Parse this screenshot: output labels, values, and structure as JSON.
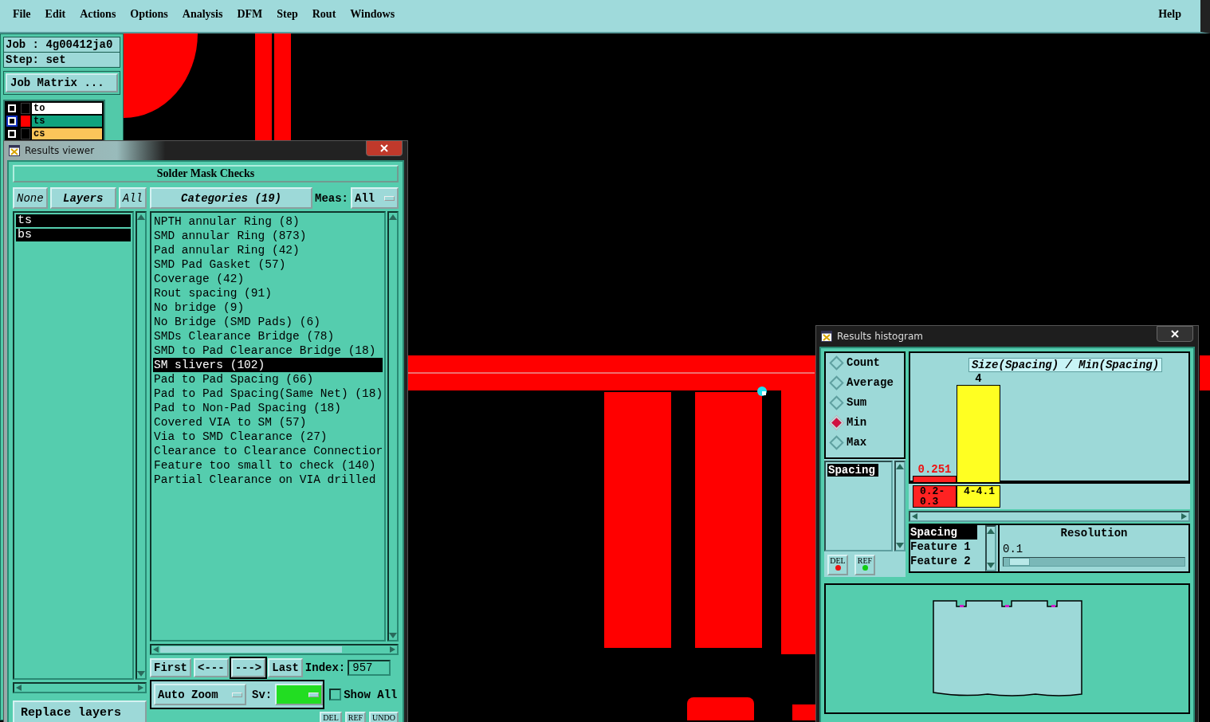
{
  "menu_bar": {
    "items": [
      "File",
      "Edit",
      "Actions",
      "Options",
      "Analysis",
      "DFM",
      "Step",
      "Rout",
      "Windows"
    ],
    "help": "Help"
  },
  "job_panel": {
    "job": "Job : 4g00412ja0",
    "step": "Step: set",
    "matrix_button": "Job Matrix ...",
    "layers": [
      {
        "name": "to",
        "color": "#ffffff",
        "checked": true,
        "selected": false
      },
      {
        "name": "ts",
        "color": "#0fa37f",
        "checked": true,
        "selected": true
      },
      {
        "name": "cs",
        "color": "#fbc55a",
        "checked": true,
        "selected": false
      }
    ]
  },
  "results_viewer": {
    "title": "Results viewer",
    "heading": "Solder Mask Checks",
    "layer_buttons": [
      "None",
      "Layers",
      "All"
    ],
    "layers": [
      {
        "name": "ts",
        "selected": true
      },
      {
        "name": "bs",
        "selected": true
      }
    ],
    "categories_button": "Categories (19)",
    "meas_label": "Meas:",
    "meas_value": "All",
    "categories": [
      {
        "label": "NPTH annular Ring (8)",
        "selected": false
      },
      {
        "label": "SMD annular Ring (873)",
        "selected": false
      },
      {
        "label": "Pad annular Ring (42)",
        "selected": false
      },
      {
        "label": "SMD Pad Gasket (57)",
        "selected": false
      },
      {
        "label": "Coverage (42)",
        "selected": false
      },
      {
        "label": "Rout spacing (91)",
        "selected": false
      },
      {
        "label": "No bridge (9)",
        "selected": false
      },
      {
        "label": "No Bridge (SMD Pads) (6)",
        "selected": false
      },
      {
        "label": "SMDs Clearance Bridge (78)",
        "selected": false
      },
      {
        "label": "SMD to Pad Clearance Bridge (18)",
        "selected": false
      },
      {
        "label": "SM slivers (102)",
        "selected": true
      },
      {
        "label": "Pad to Pad Spacing (66)",
        "selected": false
      },
      {
        "label": "Pad to Pad Spacing(Same Net) (18)",
        "selected": false
      },
      {
        "label": "Pad to Non-Pad Spacing (18)",
        "selected": false
      },
      {
        "label": "Covered VIA to SM (57)",
        "selected": false
      },
      {
        "label": "Via to SMD Clearance (27)",
        "selected": false
      },
      {
        "label": "Clearance to Clearance Connectior",
        "selected": false
      },
      {
        "label": "Feature too small to check (140)",
        "selected": false
      },
      {
        "label": "Partial Clearance on VIA drilled",
        "selected": false
      }
    ],
    "nav_buttons": [
      {
        "label": "First",
        "selected": false
      },
      {
        "label": "<---",
        "selected": false
      },
      {
        "label": "--->",
        "selected": true
      },
      {
        "label": "Last",
        "selected": false
      }
    ],
    "index_label": "Index:",
    "index_value": "957",
    "zoom_menu": "Auto Zoom",
    "sv_label": "Sv:",
    "show_all": {
      "label": "Show All",
      "checked": false
    },
    "replace_button": "Replace layers",
    "edit_buttons": [
      "DEL",
      "REF",
      "UNDO"
    ]
  },
  "results_histogram": {
    "title": "Results histogram",
    "modes": [
      {
        "label": "Count",
        "selected": false
      },
      {
        "label": "Average",
        "selected": false
      },
      {
        "label": "Sum",
        "selected": false
      },
      {
        "label": "Min",
        "selected": true
      },
      {
        "label": "Max",
        "selected": false
      }
    ],
    "measures": [
      {
        "label": "Spacing",
        "selected": true
      }
    ],
    "buttons": [
      {
        "label": "DEL",
        "color": "#ee1111"
      },
      {
        "label": "REF",
        "color": "#11cc11"
      }
    ],
    "chart_data": {
      "type": "bar",
      "title": "Size(Spacing) / Min(Spacing)",
      "categories": [
        "0.2-0.3",
        "4-4.1"
      ],
      "values": [
        0.251,
        4
      ],
      "data_labels": true
    },
    "fields": [
      {
        "label": "Spacing",
        "selected": true
      },
      {
        "label": "Feature 1",
        "selected": false
      },
      {
        "label": "Feature 2",
        "selected": false
      }
    ],
    "resolution_label": "Resolution",
    "resolution_value": "0.1",
    "resolution_slider": {
      "level": 0.03
    }
  }
}
